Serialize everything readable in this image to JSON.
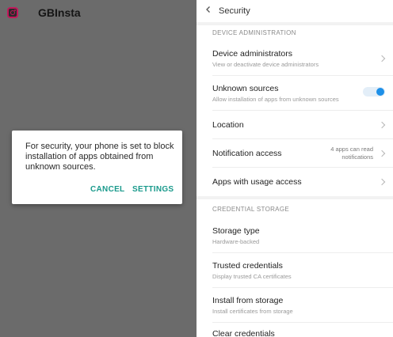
{
  "left_app": {
    "title": "GBInsta",
    "icon": "instagram-icon",
    "dialog": {
      "message": "For security, your phone is set to block installation of apps obtained from unknown sources.",
      "cancel_label": "CANCEL",
      "settings_label": "SETTINGS",
      "accent_color": "#1a9a8c"
    }
  },
  "security": {
    "title": "Security",
    "back_icon": "chevron-left-icon",
    "sections": [
      {
        "label": "DEVICE ADMINISTRATION",
        "rows": [
          {
            "title": "Device administrators",
            "subtitle": "View or deactivate device administrators"
          },
          {
            "title": "Unknown sources",
            "subtitle": "Allow installation of apps from unknown sources",
            "toggle_on": true
          },
          {
            "title": "Location"
          },
          {
            "title": "Notification access",
            "value": "4 apps can read notifications"
          },
          {
            "title": "Apps with usage access"
          }
        ]
      },
      {
        "label": "CREDENTIAL STORAGE",
        "rows": [
          {
            "title": "Storage type",
            "subtitle": "Hardware-backed"
          },
          {
            "title": "Trusted credentials",
            "subtitle": "Display trusted CA certificates"
          },
          {
            "title": "Install from storage",
            "subtitle": "Install certificates from storage"
          },
          {
            "title": "Clear credentials"
          }
        ]
      }
    ],
    "toggle_color": "#1e90e8"
  }
}
